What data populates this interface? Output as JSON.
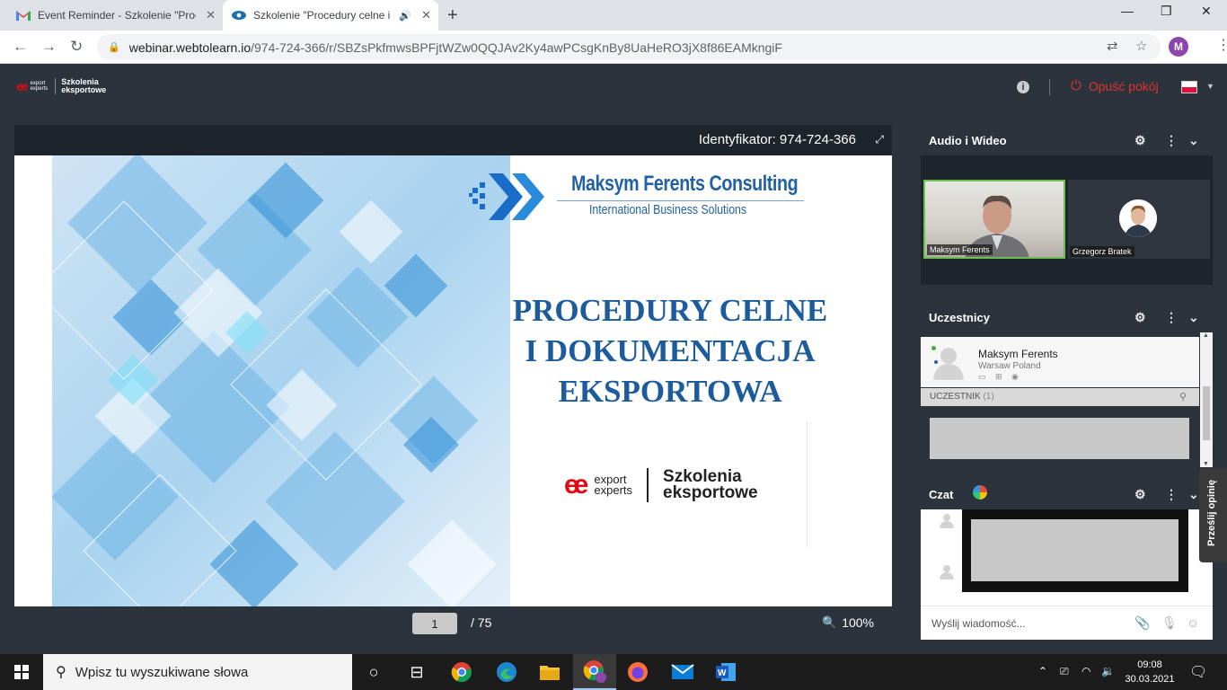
{
  "browser": {
    "tabs": [
      {
        "title": "Event Reminder - Szkolenie \"Proc",
        "icon": "gmail-icon"
      },
      {
        "title": "Szkolenie \"Procedury celne i",
        "icon": "webtolearn-icon"
      }
    ],
    "url_host": "webinar.webtolearn.io",
    "url_path": "/974-724-366/r/SBZsPkfmwsBPFjtWZw0QQJAv2Ky4awPCsgKnBy8UaHeRO3jX8f86EAMkngiF",
    "profile_initial": "M"
  },
  "header": {
    "brand_ee": "ee",
    "brand_export": "export",
    "brand_experts": "experts",
    "brand_szkolenia": "Szkolenia",
    "brand_eksportowe": "eksportowe",
    "leave_label": "Opuść pokój",
    "accent_color": "#e5322d"
  },
  "presentation": {
    "id_label": "Identyfikator: 974-724-366",
    "slide": {
      "company": "Maksym Ferents Consulting",
      "tagline": "International Business Solutions",
      "title_lines": [
        "PROCEDURY CELNE",
        "I DOKUMENTACJA",
        "EKSPORTOWA"
      ],
      "footer_ee": "ee",
      "footer_export": "export",
      "footer_experts": "experts",
      "footer_szkolenia": "Szkolenia",
      "footer_eksportowe": "eksportowe"
    },
    "page_current": "1",
    "page_total": "/ 75",
    "zoom": "100%"
  },
  "audio_video": {
    "title": "Audio i Wideo",
    "participants": [
      "Maksym Ferents",
      "Grzegorz Bratek"
    ]
  },
  "participants": {
    "title": "Uczestnicy",
    "host": {
      "name": "Maksym Ferents",
      "location": "Warsaw Poland",
      "devices": "▭ ⊞ ◉"
    },
    "role_label": "UCZESTNIK",
    "role_count": "(1)"
  },
  "chat": {
    "title": "Czat",
    "input_placeholder": "Wyślij wiadomość..."
  },
  "feedback_label": "Prześlij opinię",
  "taskbar": {
    "search_placeholder": "Wpisz tu wyszukiwane słowa",
    "time": "09:08",
    "date": "30.03.2021"
  }
}
